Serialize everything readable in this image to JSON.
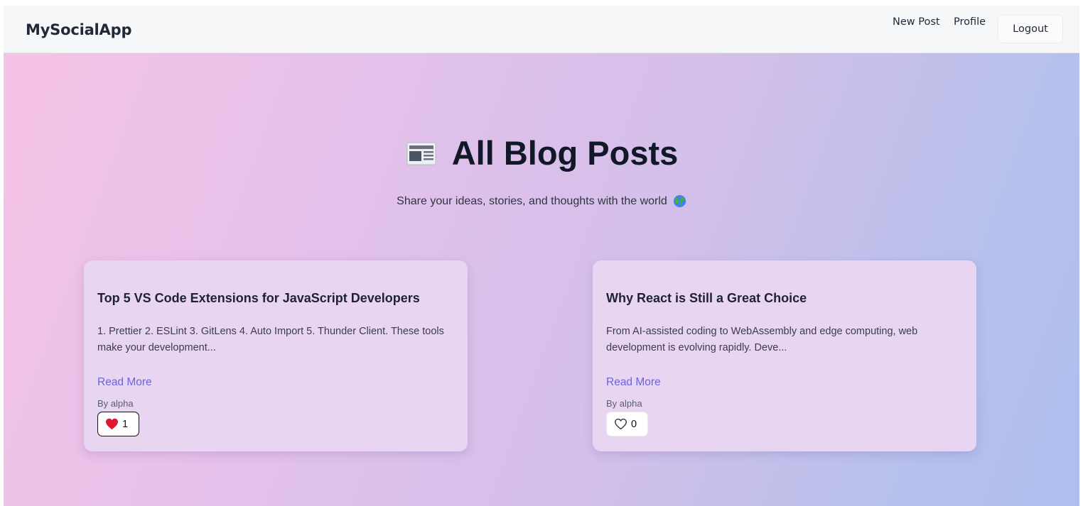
{
  "navbar": {
    "brand": "MySocialApp",
    "links": [
      "New Post",
      "Profile"
    ],
    "logout_label": "Logout"
  },
  "hero": {
    "title": "All Blog Posts",
    "title_icon": "newspaper-icon",
    "subtitle": "Share your ideas, stories, and thoughts with the world",
    "subtitle_icon": "globe-icon"
  },
  "posts": [
    {
      "title": "Top 5 VS Code Extensions for JavaScript Developers",
      "excerpt": "1. Prettier 2. ESLint 3. GitLens 4. Auto Import 5. Thunder Client. These tools make your development...",
      "read_more": "Read More",
      "author": "By alpha",
      "likes": "1",
      "liked": true
    },
    {
      "title": "Why React is Still a Great Choice",
      "excerpt": "From AI-assisted coding to WebAssembly and edge computing, web development is evolving rapidly. Deve...",
      "read_more": "Read More",
      "author": "By alpha",
      "likes": "0",
      "liked": false
    }
  ],
  "colors": {
    "accent_link": "#6a63dc",
    "heart_filled": "#e0182d",
    "gradient_start": "#f6c3e6",
    "gradient_end": "#aebeee"
  }
}
